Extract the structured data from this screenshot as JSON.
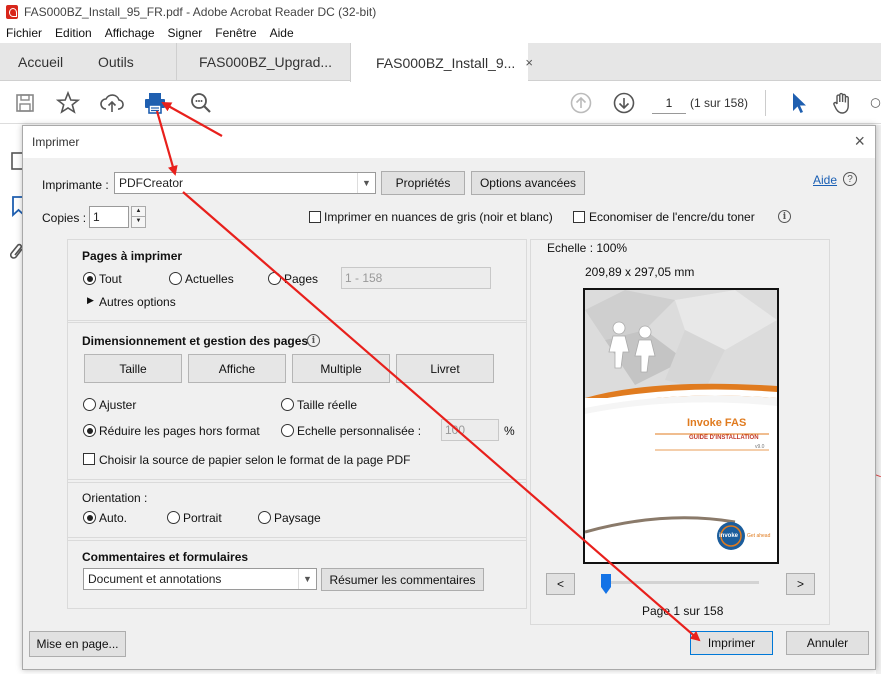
{
  "window": {
    "title": "FAS000BZ_Install_95_FR.pdf - Adobe Acrobat Reader DC (32-bit)"
  },
  "menu": [
    "Fichier",
    "Edition",
    "Affichage",
    "Signer",
    "Fenêtre",
    "Aide"
  ],
  "tabs": {
    "home": "Accueil",
    "tools": "Outils",
    "doc1": "FAS000BZ_Upgrad...",
    "doc2": "FAS000BZ_Install_9...",
    "close": "×"
  },
  "toolbar": {
    "page_current": "1",
    "page_total": "(1 sur 158)"
  },
  "dialog": {
    "title": "Imprimer",
    "close": "×",
    "printer_label": "Imprimante :",
    "printer_value": "PDFCreator",
    "properties_button": "Propriétés",
    "advanced_button": "Options avancées",
    "help_link": "Aide",
    "copies_label": "Copies :",
    "copies_value": "1",
    "grayscale_label": "Imprimer en nuances de gris (noir et blanc)",
    "save_ink_label": "Economiser de l'encre/du toner",
    "pages_section": {
      "title": "Pages à imprimer",
      "all": "Tout",
      "current": "Actuelles",
      "pages": "Pages",
      "range_value": "1 - 158",
      "more_options": "Autres options"
    },
    "sizing_section": {
      "title": "Dimensionnement et gestion des pages",
      "size_button": "Taille",
      "poster_button": "Affiche",
      "multiple_button": "Multiple",
      "booklet_button": "Livret",
      "fit": "Ajuster",
      "actual_size": "Taille réelle",
      "shrink": "Réduire les pages hors format",
      "custom_scale": "Echelle personnalisée :",
      "custom_scale_value": "100",
      "percent": "%",
      "paper_source": "Choisir la source de papier selon le format de la page PDF"
    },
    "orientation_section": {
      "title": "Orientation :",
      "auto": "Auto.",
      "portrait": "Portrait",
      "landscape": "Paysage"
    },
    "comments_section": {
      "title": "Commentaires et formulaires",
      "value": "Document et annotations",
      "summarize_button": "Résumer les commentaires"
    },
    "preview": {
      "scale": "Echelle : 100%",
      "dimensions": "209,89 x 297,05 mm",
      "prev": "<",
      "next": ">",
      "page_info": "Page 1 sur 158",
      "doc_title": "Invoke FAS",
      "doc_subtitle": "GUIDE D'INSTALLATION",
      "doc_version": "v9.0",
      "logo_text": "invoke",
      "logo_tag": "Get ahead"
    },
    "page_setup_button": "Mise en page...",
    "print_button": "Imprimer",
    "cancel_button": "Annuler"
  },
  "colors": {
    "arrow": "#e8201c",
    "accent": "#1473e6",
    "orange": "#e07b1f"
  }
}
